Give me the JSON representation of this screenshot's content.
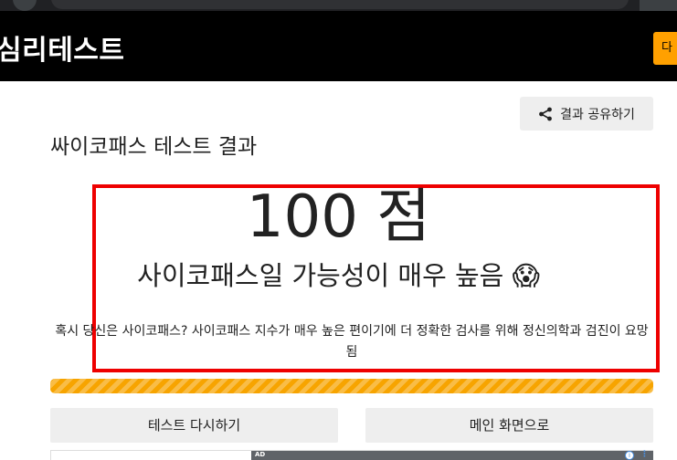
{
  "header": {
    "site_title": "심리테스트",
    "cta_label": "다"
  },
  "share": {
    "label": "결과 공유하기",
    "icon": "share-icon"
  },
  "page": {
    "title": "싸이코패스 테스트 결과"
  },
  "result": {
    "score": "100 점",
    "verdict": "사이코패스일 가능성이 매우 높음 😱",
    "description": "혹시 당신은 사이코패스? 사이코패스 지수가 매우 높은 편이기에 더 정확한 검사를 위해 정신의학과 검진이 요망됨",
    "progress_percent": 100
  },
  "actions": {
    "retry_label": "테스트 다시하기",
    "home_label": "메인 화면으로"
  },
  "ad": {
    "label": "AD",
    "info_icon": "info-icon",
    "info_glyph": "i",
    "more_glyph": "⋮"
  },
  "colors": {
    "header_bg": "#000000",
    "accent": "#f7a400",
    "highlight_border": "#ee0000"
  }
}
